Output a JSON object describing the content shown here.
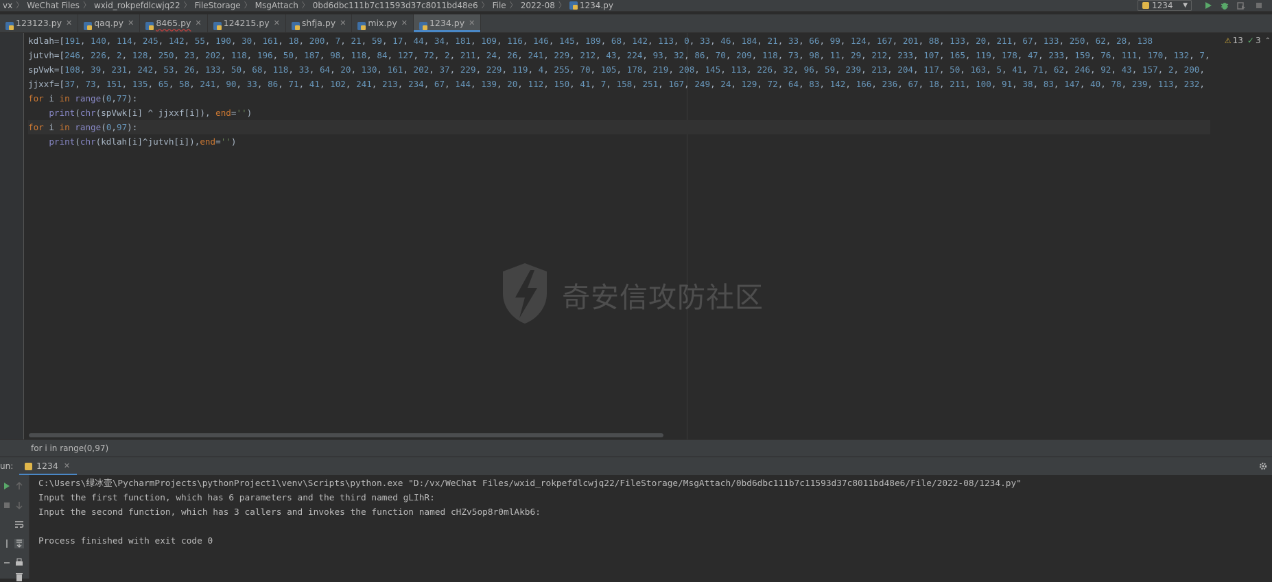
{
  "breadcrumb": [
    "vx",
    "WeChat Files",
    "wxid_rokpefdlcwjq22",
    "FileStorage",
    "MsgAttach",
    "0bd6dbc111b7c11593d37c8011bd48e6",
    "File",
    "2022-08",
    "1234.py"
  ],
  "run_config": {
    "label": "1234"
  },
  "tabs": [
    {
      "label": "123123.py",
      "active": false,
      "error": false
    },
    {
      "label": "qaq.py",
      "active": false,
      "error": false
    },
    {
      "label": "8465.py",
      "active": false,
      "error": true
    },
    {
      "label": "124215.py",
      "active": false,
      "error": false
    },
    {
      "label": "shfja.py",
      "active": false,
      "error": false
    },
    {
      "label": "mix.py",
      "active": false,
      "error": false
    },
    {
      "label": "1234.py",
      "active": true,
      "error": false
    }
  ],
  "inspection": {
    "warnings": "13",
    "ok": "3"
  },
  "code_lines": [
    "kdlah=[191, 140, 114, 245, 142, 55, 190, 30, 161, 18, 200, 7, 21, 59, 17, 44, 34, 181, 109, 116, 146, 145, 189, 68, 142, 113, 0, 33, 46, 184, 21, 33, 66, 99, 124, 167, 201, 88, 133, 20, 211, 67, 133, 250, 62, 28, 138",
    "jutvh=[246, 226, 2, 128, 250, 23, 202, 118, 196, 50, 187, 98, 118, 84, 127, 72, 2, 211, 24, 26, 241, 229, 212, 43, 224, 93, 32, 86, 70, 209, 118, 73, 98, 11, 29, 212, 233, 107, 165, 119, 178, 47, 233, 159, 76, 111, 170, 132, 7,",
    "spVwk=[108, 39, 231, 242, 53, 26, 133, 50, 68, 118, 33, 64, 20, 130, 161, 202, 37, 229, 229, 119, 4, 255, 70, 105, 178, 219, 208, 145, 113, 226, 32, 96, 59, 239, 213, 204, 117, 50, 163, 5, 41, 71, 62, 246, 92, 43, 157, 2, 200,",
    "jjxxf=[37, 73, 151, 135, 65, 58, 241, 90, 33, 86, 71, 41, 102, 241, 213, 234, 67, 144, 139, 20, 112, 150, 41, 7, 158, 251, 167, 249, 24, 129, 72, 64, 83, 142, 166, 236, 67, 18, 211, 100, 91, 38, 83, 147, 40, 78, 239, 113, 232,",
    "for i in range(0,77):",
    "    print(chr(spVwk[i] ^ jjxxf[i]), end='')",
    "for i in range(0,97):",
    "    print(chr(kdlah[i]^jutvh[i]),end='')"
  ],
  "watermark": "奇安信攻防社区",
  "context_line": "for i in range(0,97)",
  "run": {
    "label": "un:",
    "tab": "1234",
    "console": [
      "C:\\Users\\绿冰壶\\PycharmProjects\\pythonProject1\\venv\\Scripts\\python.exe \"D:/vx/WeChat Files/wxid_rokpefdlcwjq22/FileStorage/MsgAttach/0bd6dbc111b7c11593d37c8011bd48e6/File/2022-08/1234.py\"",
      "Input the first function, which has 6 parameters and the third named gLIhR:",
      "Input the second function, which has 3 callers and invokes the function named cHZv5op8r0mlAkb6:",
      "",
      "Process finished with exit code 0"
    ]
  },
  "colors": {
    "keyword": "#cc7832",
    "number": "#6897bb",
    "builtin": "#8888c6",
    "string": "#6a8759",
    "accent": "#4a88c7"
  }
}
